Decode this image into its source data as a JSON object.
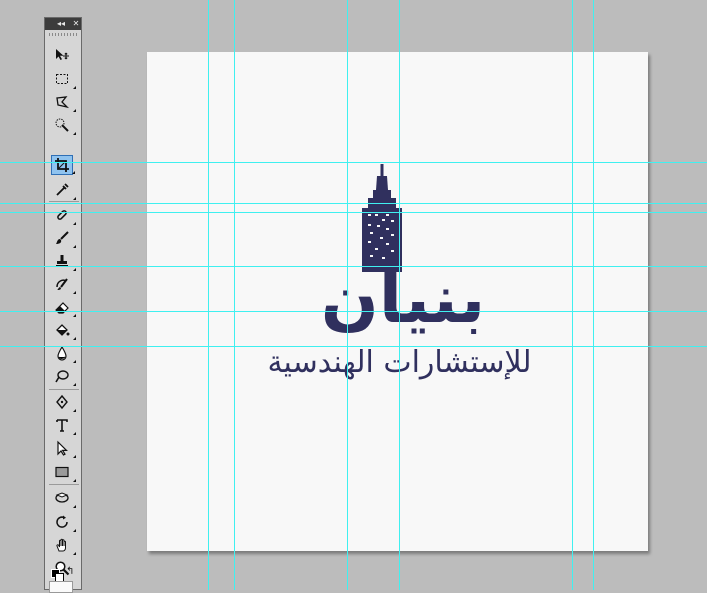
{
  "panel": {
    "collapse_glyph": "◂◂",
    "close_glyph": "✕",
    "tools": [
      {
        "name": "move-tool-icon"
      },
      {
        "name": "rectangular-marquee-tool-icon"
      },
      {
        "name": "lasso-tool-icon"
      },
      {
        "name": "quick-selection-tool-icon"
      },
      {
        "name": "crop-tool-icon",
        "active": true
      },
      {
        "name": "eyedropper-tool-icon"
      },
      {
        "name": "spot-healing-brush-tool-icon"
      },
      {
        "name": "brush-tool-icon"
      },
      {
        "name": "clone-stamp-tool-icon"
      },
      {
        "name": "history-brush-tool-icon"
      },
      {
        "name": "eraser-tool-icon"
      },
      {
        "name": "paint-bucket-tool-icon"
      },
      {
        "name": "blur-tool-icon"
      },
      {
        "name": "dodge-tool-icon"
      },
      {
        "name": "pen-tool-icon"
      },
      {
        "name": "type-tool-icon"
      },
      {
        "name": "path-selection-tool-icon"
      },
      {
        "name": "rectangle-shape-tool-icon"
      },
      {
        "name": "3d-rotate-tool-icon"
      },
      {
        "name": "3d-orbit-tool-icon"
      },
      {
        "name": "hand-tool-icon"
      },
      {
        "name": "zoom-tool-icon"
      }
    ],
    "swap_glyph": "↰",
    "foreground_color": "#000000",
    "background_color": "#ffffff"
  },
  "canvas": {
    "logo_wordmark": "بنيان",
    "logo_subtitle": "للإستشارات الهندسية",
    "logo_color": "#30305e"
  },
  "guides": {
    "color": "#3ff0f0"
  }
}
